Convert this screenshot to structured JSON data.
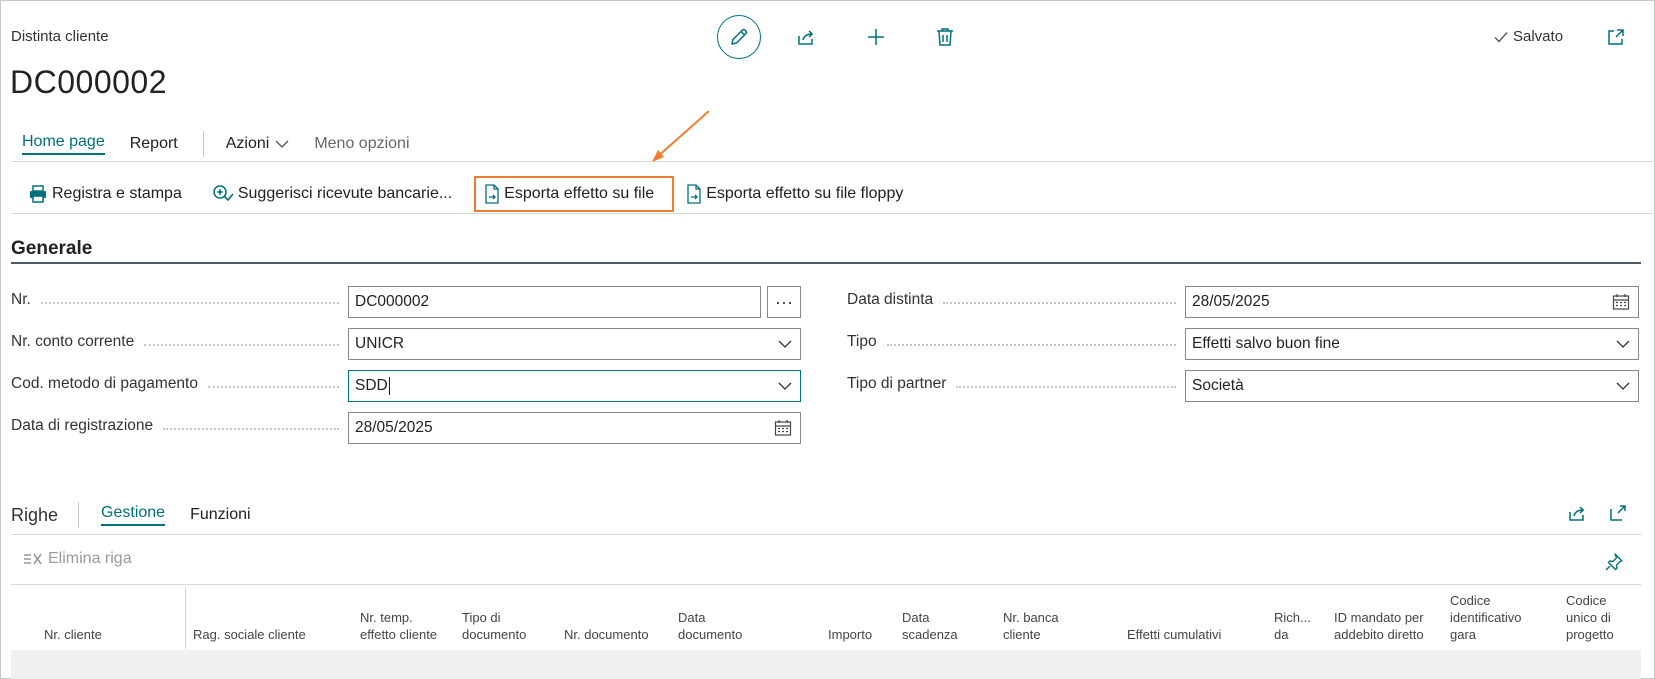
{
  "header": {
    "caption": "Distinta cliente",
    "title": "DC000002",
    "saved_label": "Salvato"
  },
  "tabs": {
    "home": "Home page",
    "report": "Report",
    "actions": "Azioni",
    "fewer_options": "Meno opzioni"
  },
  "actions": {
    "post_and_print": "Registra e stampa",
    "suggest_receipts": "Suggerisci ricevute bancarie...",
    "export_file": "Esporta effetto su file",
    "export_floppy": "Esporta effetto su file floppy"
  },
  "general": {
    "section_title": "Generale",
    "fields": [
      {
        "label": "Nr.",
        "value": "DC000002",
        "lookup_glyph": "···"
      },
      {
        "label": "Nr. conto corrente",
        "value": "UNICR"
      },
      {
        "label": "Cod. metodo di pagamento",
        "value": "SDD"
      },
      {
        "label": "Data di registrazione",
        "value": "28/05/2025"
      },
      {
        "label": "Data distinta",
        "value": "28/05/2025"
      },
      {
        "label": "Tipo",
        "value": "Effetti salvo buon fine"
      },
      {
        "label": "Tipo di partner",
        "value": "Società"
      }
    ]
  },
  "lines": {
    "title": "Righe",
    "tabs": [
      "Gestione",
      "Funzioni"
    ],
    "delete_line": "Elimina riga",
    "columns": [
      "Nr. cliente",
      "Rag. sociale cliente",
      "Nr. temp. effetto cliente",
      "Tipo di documento",
      "Nr. documento",
      "Data documento",
      "Importo",
      "Data scadenza",
      "Nr. banca cliente",
      "Effetti cumulativi",
      "Rich... da",
      "ID mandato per addebito diretto",
      "Codice identificativo gara",
      "Codice unico di progetto"
    ]
  },
  "colors": {
    "accent": "#00707a",
    "highlight": "#ef7d2f"
  }
}
